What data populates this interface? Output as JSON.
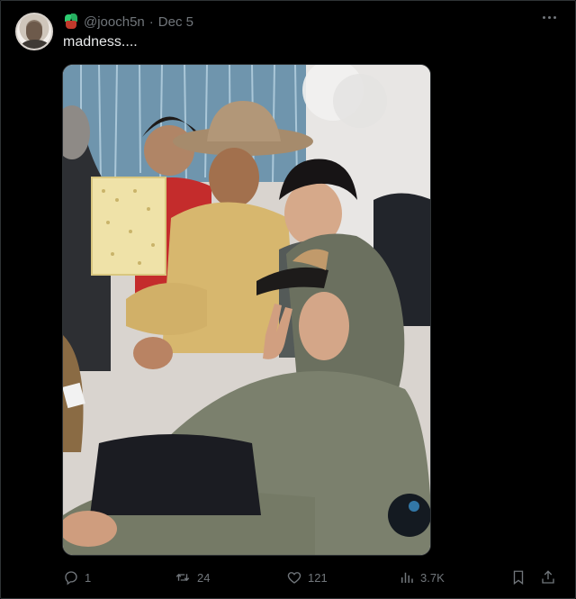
{
  "post": {
    "handle": "@jooch5n",
    "separator": "·",
    "date": "Dec 5",
    "text": "madness...."
  },
  "media": {
    "description_icon": "photo"
  },
  "actions": {
    "reply_count": "1",
    "repost_count": "24",
    "like_count": "121",
    "views_count": "3.7K"
  },
  "colors": {
    "background": "#000000",
    "text_primary": "#e7e9ea",
    "text_secondary": "#71767b",
    "border": "#2f3336"
  },
  "icons": [
    "plant-emoji-icon",
    "more-icon",
    "reply-icon",
    "repost-icon",
    "like-icon",
    "views-icon",
    "bookmark-icon",
    "share-icon"
  ]
}
